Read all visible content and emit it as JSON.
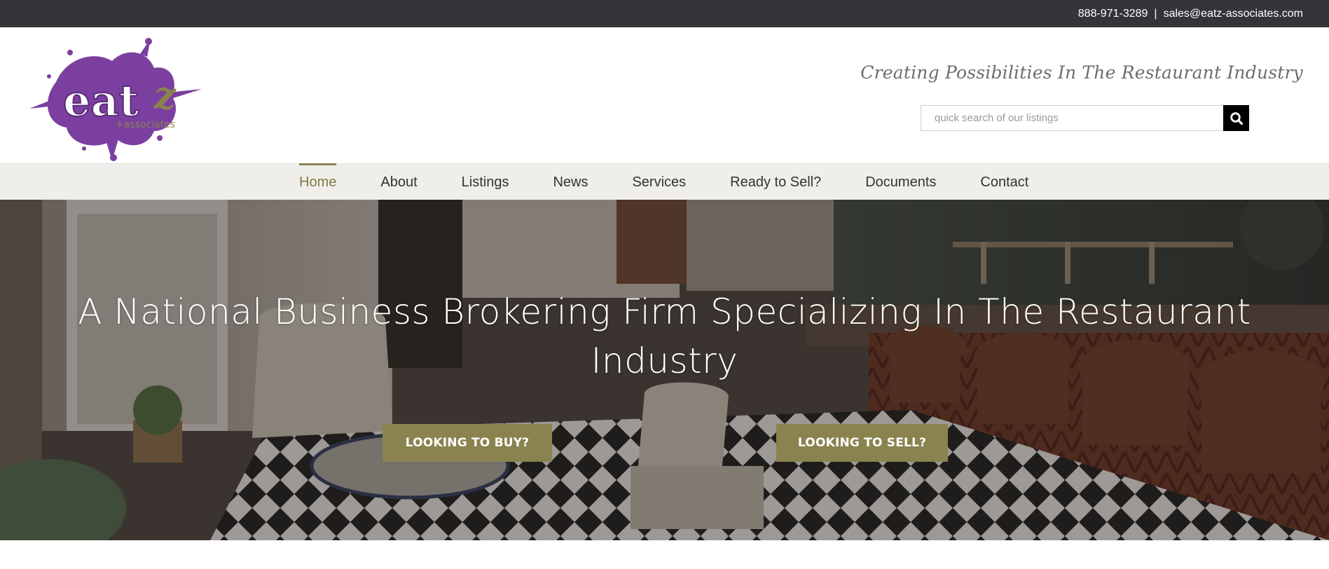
{
  "topbar": {
    "phone": "888-971-3289",
    "separator": "|",
    "email": "sales@eatz-associates.com"
  },
  "header": {
    "logo_main": "eatz",
    "logo_sub": "associates",
    "tagline": "Creating Possibilities In The Restaurant Industry",
    "search": {
      "placeholder": "quick search of our listings",
      "icon": "search-icon"
    }
  },
  "nav": {
    "items": [
      {
        "label": "Home",
        "active": true
      },
      {
        "label": "About"
      },
      {
        "label": "Listings"
      },
      {
        "label": "News"
      },
      {
        "label": "Services"
      },
      {
        "label": "Ready to Sell?"
      },
      {
        "label": "Documents"
      },
      {
        "label": "Contact"
      }
    ]
  },
  "hero": {
    "title_line1": "A National Business Brokering Firm Specializing In The Restaurant",
    "title_line2": "Industry",
    "buy_button": "LOOKING TO BUY?",
    "sell_button": "LOOKING TO SELL?"
  },
  "colors": {
    "topbar_bg": "#333538",
    "accent": "#8a8350",
    "nav_active": "#827a45",
    "nav_bg": "#efeeea",
    "logo_purple": "#7b3fa0"
  }
}
